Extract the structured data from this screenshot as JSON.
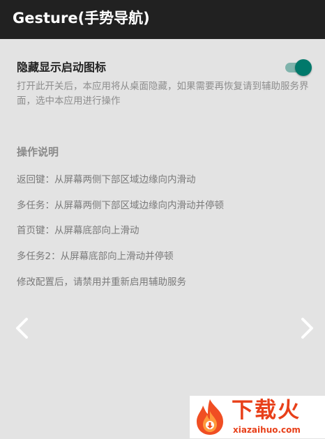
{
  "app_bar": {
    "title": "Gesture(手势导航)"
  },
  "setting": {
    "title": "隐藏显示启动图标",
    "description": "打开此开关后，本应用将从桌面隐藏，如果需要再恢复请到辅助服务界面，选中本应用进行操作",
    "toggle_on": true,
    "toggle_color": "#00796b"
  },
  "instructions": {
    "header": "操作说明",
    "items": [
      "返回键：从屏幕两侧下部区域边缘向内滑动",
      "多任务：从屏幕两侧下部区域边缘向内滑动并停顿",
      "首页键：从屏幕底部向上滑动",
      "多任务2：从屏幕底部向上滑动并停顿",
      "修改配置后，请禁用并重新启用辅助服务"
    ]
  },
  "navigation": {
    "left_icon": "chevron-left-icon",
    "right_icon": "chevron-right-icon"
  },
  "watermark": {
    "name": "下载火",
    "domain": "xiazaihuo.com",
    "color": "#e8401a"
  }
}
